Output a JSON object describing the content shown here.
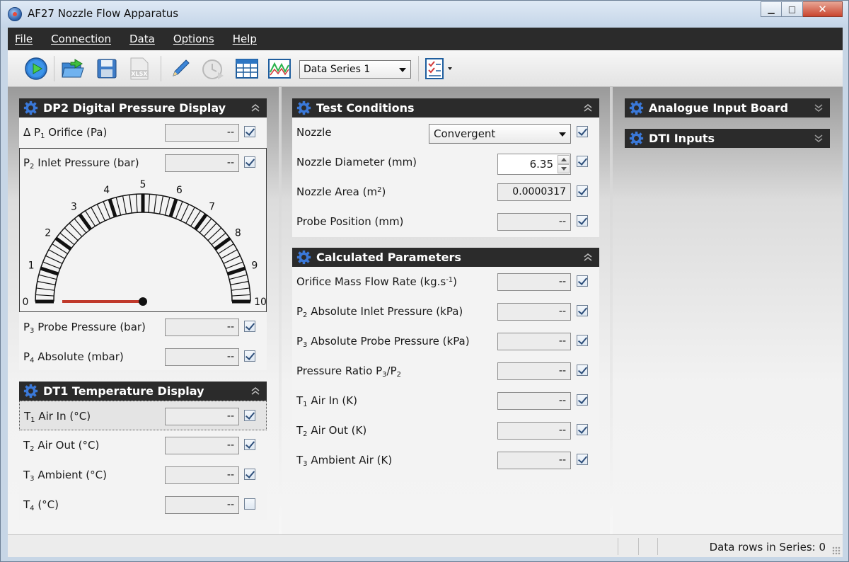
{
  "window": {
    "title": "AF27 Nozzle Flow Apparatus"
  },
  "menu": [
    "File",
    "Connection",
    "Data",
    "Options",
    "Help"
  ],
  "toolbar": {
    "series_selected": "Data Series 1"
  },
  "dp2": {
    "title": "DP2 Digital Pressure Display",
    "rows": [
      {
        "pre": "Δ P",
        "sub": "1",
        "post": " Orifice  (Pa)",
        "value": "--",
        "checked": true
      },
      {
        "pre": "P",
        "sub": "2",
        "post": " Inlet Pressure  (bar)",
        "value": "--",
        "checked": true
      },
      {
        "pre": "P",
        "sub": "3",
        "post": " Probe Pressure  (bar)",
        "value": "--",
        "checked": true
      },
      {
        "pre": "P",
        "sub": "4",
        "post": " Absolute  (mbar)",
        "value": "--",
        "checked": true
      }
    ],
    "gauge": {
      "min": 0,
      "max": 10,
      "value": 0,
      "ticks": [
        "0",
        "1",
        "2",
        "3",
        "4",
        "5",
        "6",
        "7",
        "8",
        "9",
        "10"
      ]
    }
  },
  "dt1": {
    "title": "DT1 Temperature Display",
    "rows": [
      {
        "pre": "T",
        "sub": "1",
        "post": " Air In  (°C)",
        "value": "--",
        "checked": true
      },
      {
        "pre": "T",
        "sub": "2",
        "post": " Air Out  (°C)",
        "value": "--",
        "checked": true
      },
      {
        "pre": "T",
        "sub": "3",
        "post": " Ambient  (°C)",
        "value": "--",
        "checked": true
      },
      {
        "pre": "T",
        "sub": "4",
        "post": "  (°C)",
        "value": "--",
        "checked": false
      }
    ]
  },
  "test": {
    "title": "Test Conditions",
    "nozzle_label": "Nozzle",
    "nozzle_value": "Convergent",
    "diameter_label": "Nozzle Diameter  (mm)",
    "diameter_value": "6.35",
    "area_label_pre": "Nozzle Area  (m",
    "area_label_sup": "2",
    "area_label_post": ")",
    "area_value": "0.0000317",
    "probe_label": "Probe Position  (mm)",
    "probe_value": "--"
  },
  "calc": {
    "title": "Calculated Parameters",
    "rows": [
      {
        "pre": "Orifice Mass Flow Rate  (kg.s",
        "sup": "-1",
        "post": ")",
        "value": "--",
        "checked": true
      },
      {
        "pre": "P",
        "sub": "2",
        "post": " Absolute Inlet Pressure  (kPa)",
        "value": "--",
        "checked": true
      },
      {
        "pre": "P",
        "sub": "3",
        "post": " Absolute Probe Pressure  (kPa)",
        "value": "--",
        "checked": true
      },
      {
        "pre": "Pressure Ratio P",
        "sub": "3",
        "mid": "/P",
        "sub2": "2",
        "post": "",
        "value": "--",
        "checked": true
      },
      {
        "pre": "T",
        "sub": "1",
        "post": " Air In  (K)",
        "value": "--",
        "checked": true
      },
      {
        "pre": "T",
        "sub": "2",
        "post": " Air Out  (K)",
        "value": "--",
        "checked": true
      },
      {
        "pre": "T",
        "sub": "3",
        "post": " Ambient Air  (K)",
        "value": "--",
        "checked": true
      }
    ]
  },
  "right": {
    "analogue": "Analogue Input Board",
    "dti": "DTI Inputs"
  },
  "status": {
    "text": "Data rows in Series: 0"
  },
  "colors": {
    "header": "#2b2b2b",
    "needle": "#c0392b",
    "gear": "#3a78d8"
  }
}
